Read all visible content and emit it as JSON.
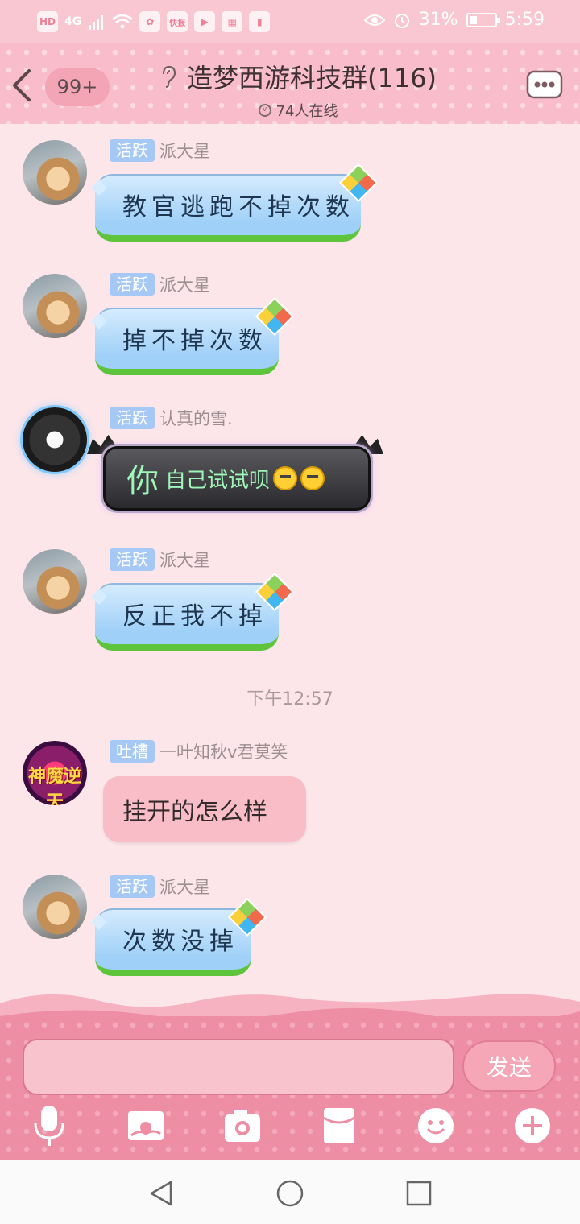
{
  "status_bar": {
    "chips": [
      "HD",
      "4G"
    ],
    "app_badges": [
      "huawei",
      "快报",
      "WATCH",
      "calendar",
      "books"
    ],
    "battery": "31%",
    "battery_level": 0.31,
    "time": "5:59"
  },
  "header": {
    "unread_count": "99+",
    "title": "造梦西游科技群(116)",
    "online": "74人在线"
  },
  "messages": [
    {
      "tag": "活跃",
      "nick": "派大星",
      "text": "教官逃跑不掉次数"
    },
    {
      "tag": "活跃",
      "nick": "派大星",
      "text": "掉不掉次数"
    },
    {
      "tag": "活跃",
      "nick": "认真的雪.",
      "text_big": "你",
      "text": "自己试试呗"
    },
    {
      "tag": "活跃",
      "nick": "派大星",
      "text": "反正我不掉"
    },
    {
      "tag": "吐槽",
      "nick": "一叶知秋v君莫笑",
      "avatar_text": "神魔逆天",
      "text": "挂开的怎么样"
    },
    {
      "tag": "活跃",
      "nick": "派大星",
      "text": "次数没掉"
    }
  ],
  "time_label": "下午12:57",
  "composer": {
    "send_label": "发送",
    "placeholder": ""
  },
  "toolbar": [
    "mic-icon",
    "picture-icon",
    "camera-icon",
    "red-packet-icon",
    "emoji-icon",
    "plus-icon"
  ],
  "colors": {
    "accent_pink": "#ee8ea5",
    "tag_blue": "#a6c8f5",
    "bubble_blue": "#9fd0f8",
    "bubble_green_border": "#5ec43b"
  }
}
